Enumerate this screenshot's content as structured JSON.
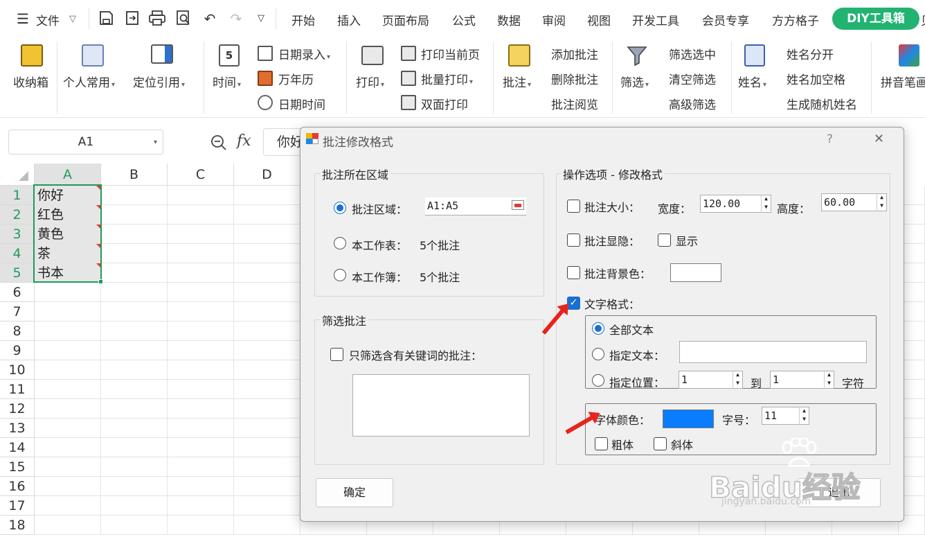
{
  "menubar": {
    "file": "文件",
    "tabs": [
      "开始",
      "插入",
      "页面布局",
      "公式",
      "数据",
      "审阅",
      "视图",
      "开发工具",
      "会员专享",
      "方方格子"
    ],
    "active_tab": "DIY工具箱",
    "overflow": "贝",
    "accent_color": "#22b371"
  },
  "ribbon": {
    "storage": "收纳箱",
    "personal": "个人常用",
    "locate": "定位引用",
    "time": "时间",
    "date_entry": "日期录入",
    "calendar": "万年历",
    "datetime": "日期时间",
    "print": "打印",
    "print_current": "打印当前页",
    "batch_print": "批量打印",
    "duplex_print": "双面打印",
    "comment": "批注",
    "add_comment": "添加批注",
    "delete_comment": "删除批注",
    "read_comment": "批注阅览",
    "filter": "筛选",
    "filter_selected": "筛选选中",
    "clear_filter": "清空筛选",
    "advanced_filter": "高级筛选",
    "name": "姓名",
    "name_split": "姓名分开",
    "name_space": "姓名加空格",
    "random_name": "生成随机姓名",
    "pinyin": "拼音笔画"
  },
  "formula_bar": {
    "cell_ref": "A1",
    "fx": "fx",
    "value": "你好"
  },
  "sheet": {
    "columns": [
      "A",
      "B",
      "C",
      "D"
    ],
    "rows": [
      "1",
      "2",
      "3",
      "4",
      "5",
      "6",
      "7",
      "8",
      "9",
      "10",
      "11",
      "12",
      "13",
      "14",
      "15",
      "16",
      "17",
      "18"
    ],
    "cells": [
      "你好",
      "红色",
      "黄色",
      "茶",
      "书本"
    ]
  },
  "dialog": {
    "title": "批注修改格式",
    "help": "?",
    "close": "✕",
    "region_group": "批注所在区域",
    "region_label": "批注区域：",
    "region_value": "A1:A5",
    "sheet_label": "本工作表：",
    "sheet_count": "5个批注",
    "book_label": "本工作簿：",
    "book_count": "5个批注",
    "filter_group": "筛选批注",
    "filter_check": "只筛选含有关键词的批注：",
    "options_group": "操作选项 - 修改格式",
    "size_label": "批注大小：",
    "width_label": "宽度：",
    "width_value": "120.00",
    "height_label": "高度：",
    "height_value": "60.00",
    "visibility_label": "批注显隐：",
    "show_label": "显示",
    "bg_label": "批注背景色：",
    "text_format_label": "文字格式：",
    "all_text": "全部文本",
    "specified_text": "指定文本：",
    "specified_pos": "指定位置：",
    "pos_from": "1",
    "to_label": "到",
    "pos_to": "1",
    "char_label": "字符",
    "font_color_label": "字体颜色：",
    "font_color": "#0a7cff",
    "font_size_label": "字号：",
    "font_size": "11",
    "bold_label": "粗体",
    "italic_label": "斜体",
    "ok": "确定",
    "exit": "退出"
  },
  "watermark": {
    "brand": "Baidu经验",
    "url": "jingyan.baidu.com"
  }
}
